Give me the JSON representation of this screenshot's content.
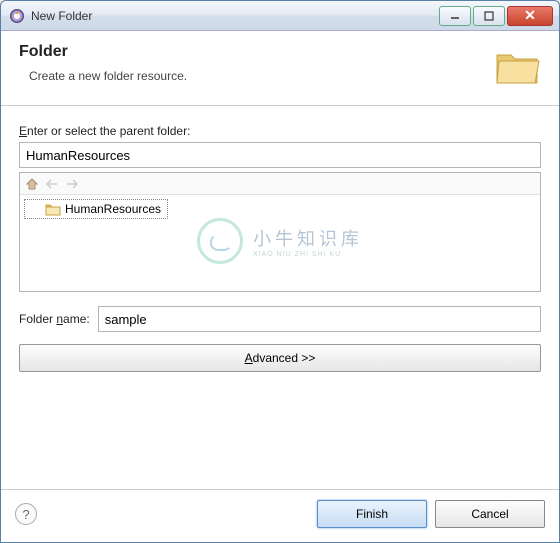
{
  "window": {
    "title": "New Folder"
  },
  "banner": {
    "title": "Folder",
    "subtitle": "Create a new folder resource."
  },
  "parent": {
    "label": "Enter or select the parent folder:",
    "value": "HumanResources"
  },
  "tree": {
    "item_label": "HumanResources"
  },
  "folderName": {
    "label": "Folder name:",
    "value": "sample"
  },
  "buttons": {
    "advanced": "Advanced >>",
    "finish": "Finish",
    "cancel": "Cancel"
  },
  "watermark": {
    "cn": "小牛知识库",
    "en": "XIAO NIU ZHI SHI KU"
  }
}
